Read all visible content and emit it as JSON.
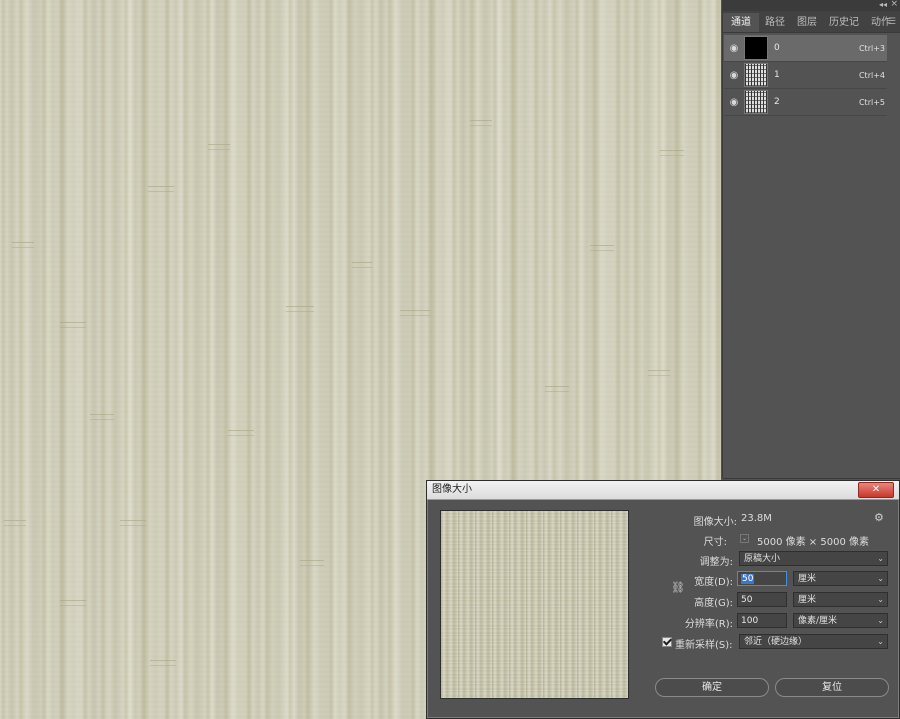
{
  "panel": {
    "tabs": [
      "通道",
      "路径",
      "图层",
      "历史记",
      "动作"
    ],
    "active_tab": 0,
    "channels": [
      {
        "name": "0",
        "shortcut": "Ctrl+3",
        "thumb": "black"
      },
      {
        "name": "1",
        "shortcut": "Ctrl+4",
        "thumb": "noise"
      },
      {
        "name": "2",
        "shortcut": "Ctrl+5",
        "thumb": "noise"
      }
    ]
  },
  "dialog": {
    "title": "图像大小",
    "close_label": "✕",
    "image_size_label": "图像大小:",
    "image_size_value": "23.8M",
    "dimensions_label": "尺寸:",
    "dimensions_value": "5000 像素 × 5000 像素",
    "fit_to_label": "调整为:",
    "fit_to_value": "原稿大小",
    "width_label": "宽度(D):",
    "width_value": "50",
    "width_unit": "厘米",
    "height_label": "高度(G):",
    "height_value": "50",
    "height_unit": "厘米",
    "resolution_label": "分辨率(R):",
    "resolution_value": "100",
    "resolution_unit": "像素/厘米",
    "resample_label": "重新采样(S):",
    "resample_checked": true,
    "resample_value": "邻近（硬边缘）",
    "ok_label": "确定",
    "reset_label": "复位"
  }
}
